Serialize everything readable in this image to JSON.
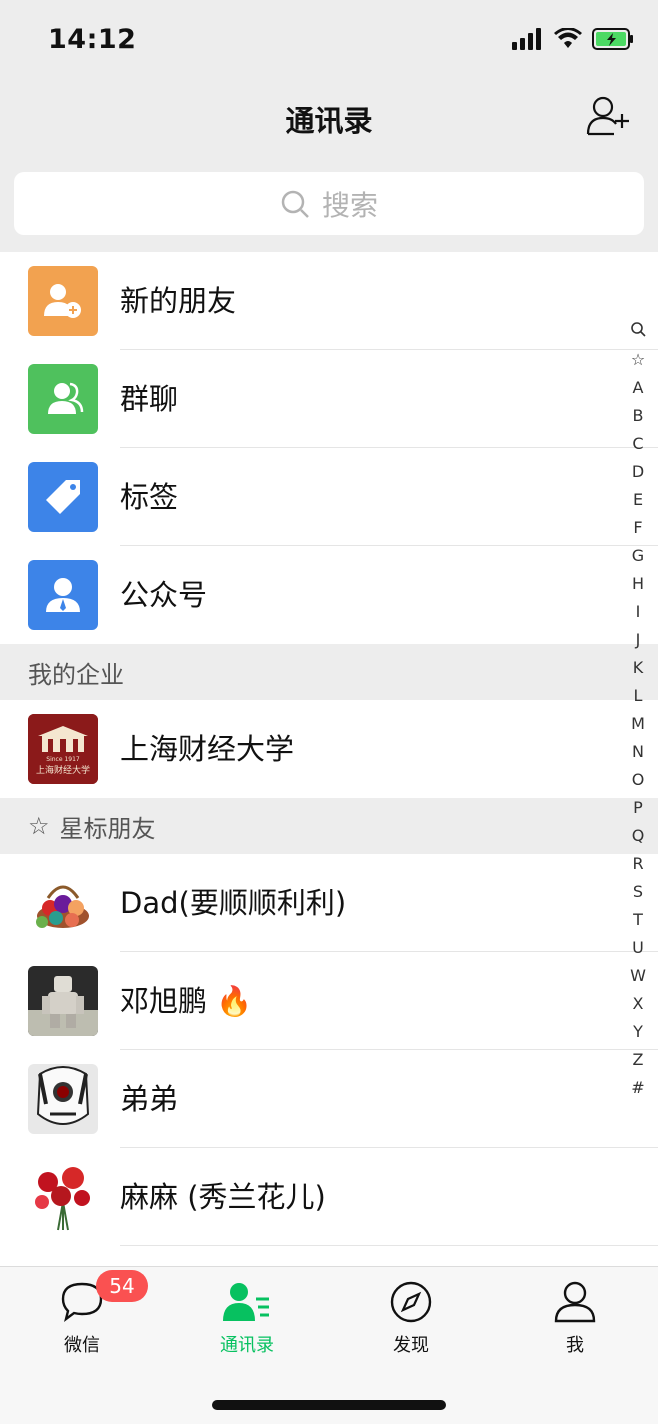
{
  "status_bar": {
    "time": "14:12"
  },
  "nav": {
    "title": "通讯录"
  },
  "search": {
    "placeholder": "搜索"
  },
  "menu_items": [
    {
      "label": "新的朋友",
      "icon": "new-friend-icon",
      "color": "#f2a250"
    },
    {
      "label": "群聊",
      "icon": "group-chat-icon",
      "color": "#4fc15d"
    },
    {
      "label": "标签",
      "icon": "tag-icon",
      "color": "#3d84e8"
    },
    {
      "label": "公众号",
      "icon": "official-account-icon",
      "color": "#3d84e8"
    }
  ],
  "enterprise_section": {
    "header": "我的企业",
    "items": [
      {
        "label": "上海财经大学",
        "logo_text": "上海财经大学",
        "since": "Since 1917"
      }
    ]
  },
  "starred_section": {
    "header": "星标朋友",
    "items": [
      {
        "label": "Dad(要顺顺利利)"
      },
      {
        "label": "邓旭鹏 🔥"
      },
      {
        "label": "弟弟"
      },
      {
        "label": "麻麻 (秀兰花儿)"
      }
    ]
  },
  "index_letters": [
    "A",
    "B",
    "C",
    "D",
    "E",
    "F",
    "G",
    "H",
    "I",
    "J",
    "K",
    "L",
    "M",
    "N",
    "O",
    "P",
    "Q",
    "R",
    "S",
    "T",
    "U",
    "W",
    "X",
    "Y",
    "Z",
    "#"
  ],
  "tabs": [
    {
      "label": "微信",
      "icon": "chat-bubble-icon"
    },
    {
      "label": "通讯录",
      "icon": "contacts-icon",
      "active": true
    },
    {
      "label": "发现",
      "icon": "compass-icon"
    },
    {
      "label": "我",
      "icon": "person-icon"
    }
  ],
  "badge": {
    "count": "54"
  },
  "colors": {
    "accent": "#07c160",
    "badge": "#fa5151"
  }
}
